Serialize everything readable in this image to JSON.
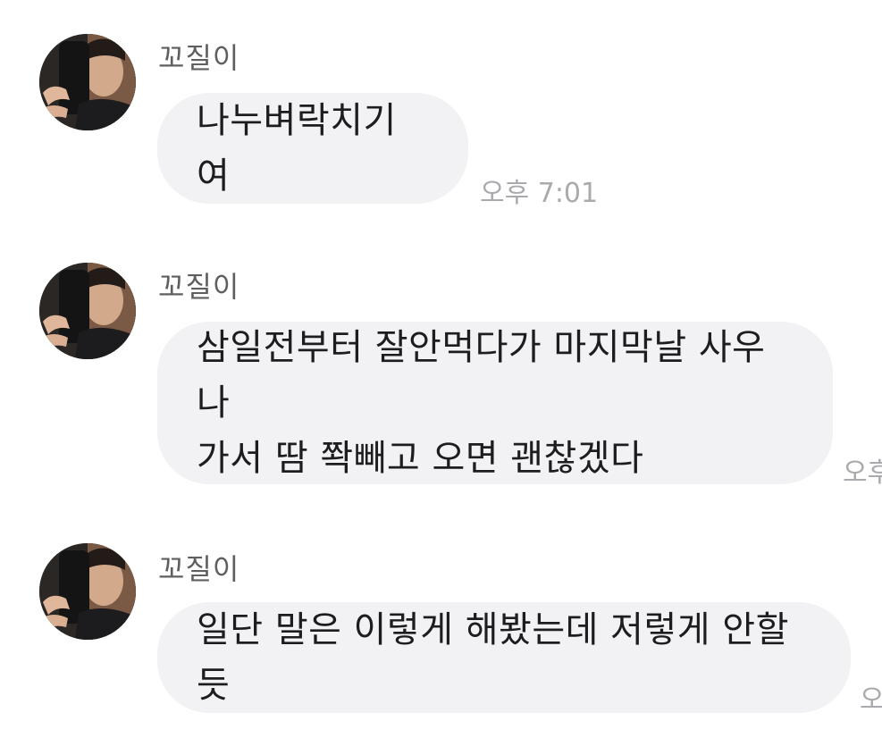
{
  "colors": {
    "bubble": "#f2f2f4",
    "message_text": "#1d1d1f",
    "sender_name": "#5f5f5f",
    "timestamp": "#a9a9ae",
    "background": "#ffffff"
  },
  "messages": [
    {
      "sender": "꼬질이",
      "avatar": "profile-photo-icon",
      "text": "나누벼락치기여",
      "time": "오후 7:01"
    },
    {
      "sender": "꼬질이",
      "avatar": "profile-photo-icon",
      "text": "삼일전부터 잘안먹다가 마지막날 사우나\n가서 땀 쫙빼고 오면 괜찮겠다",
      "time": "오후"
    },
    {
      "sender": "꼬질이",
      "avatar": "profile-photo-icon",
      "text": "일단 말은 이렇게 해봤는데 저렇게 안할듯",
      "time": "오"
    }
  ]
}
